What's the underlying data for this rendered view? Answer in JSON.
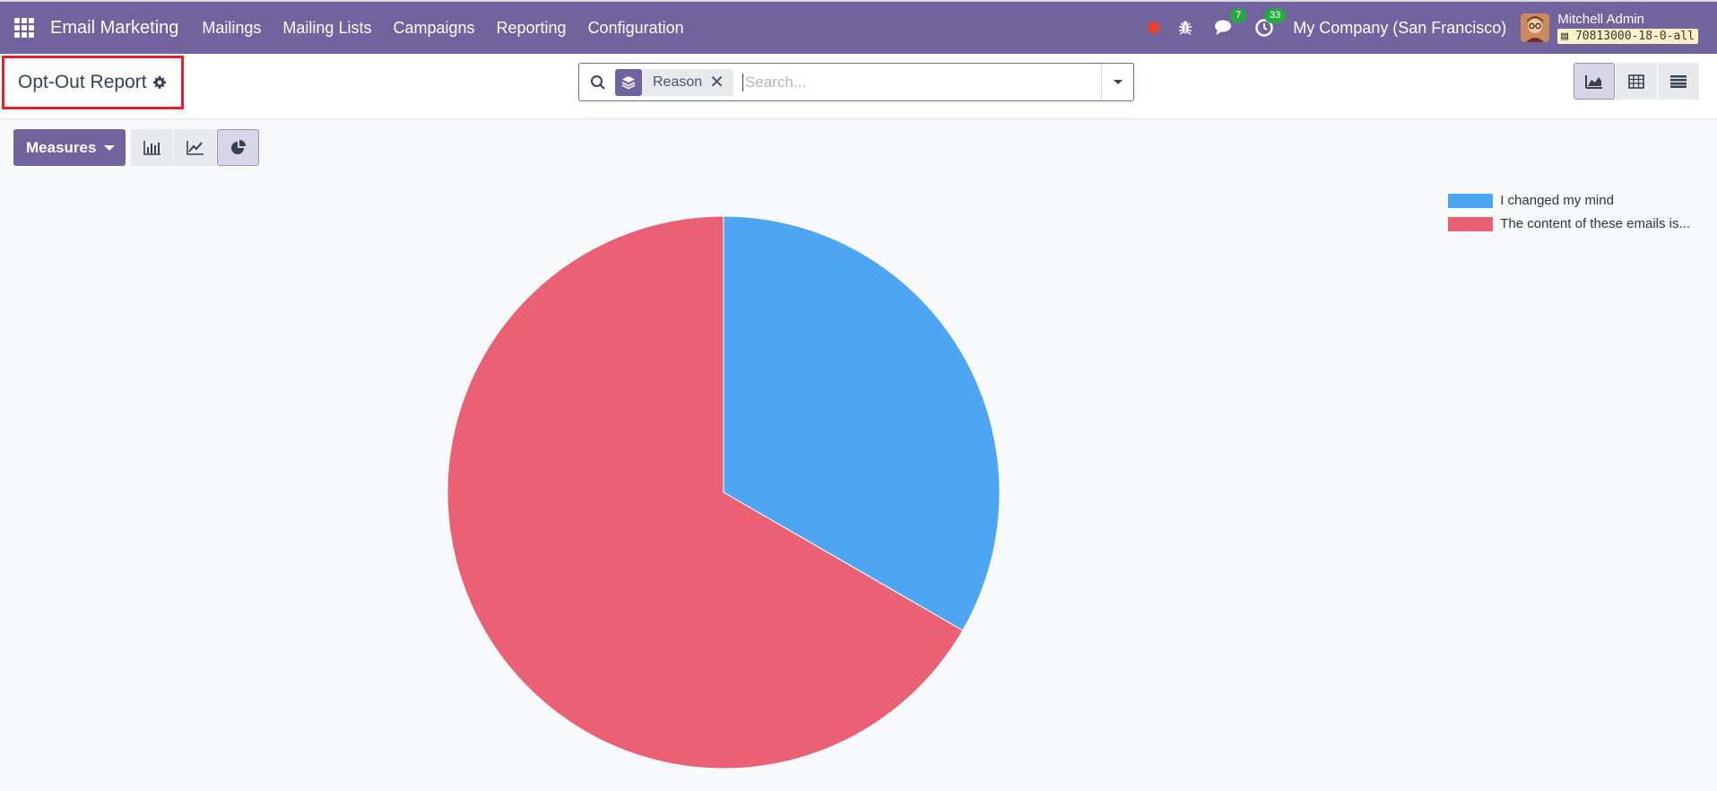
{
  "navbar": {
    "app_name": "Email Marketing",
    "menu": [
      "Mailings",
      "Mailing Lists",
      "Campaigns",
      "Reporting",
      "Configuration"
    ],
    "messages_count": "7",
    "activities_count": "33",
    "company": "My Company (San Francisco)",
    "user_name": "Mitchell Admin",
    "db_name": "70813000-18-0-all"
  },
  "control_panel": {
    "title": "Opt-Out Report",
    "facet_label": "Reason",
    "search_placeholder": "Search..."
  },
  "toolbar": {
    "measures_label": "Measures"
  },
  "colors": {
    "navbar": "#71639e",
    "slice_blue": "#4ea6f2",
    "slice_red": "#ea6074",
    "highlight": "#e0202c"
  },
  "chart_data": {
    "type": "pie",
    "categories": [
      "I changed my mind",
      "The content of these emails is..."
    ],
    "values": [
      1,
      2
    ],
    "colors": [
      "#4ea6f2",
      "#ea6074"
    ],
    "legend_position": "top-right"
  }
}
